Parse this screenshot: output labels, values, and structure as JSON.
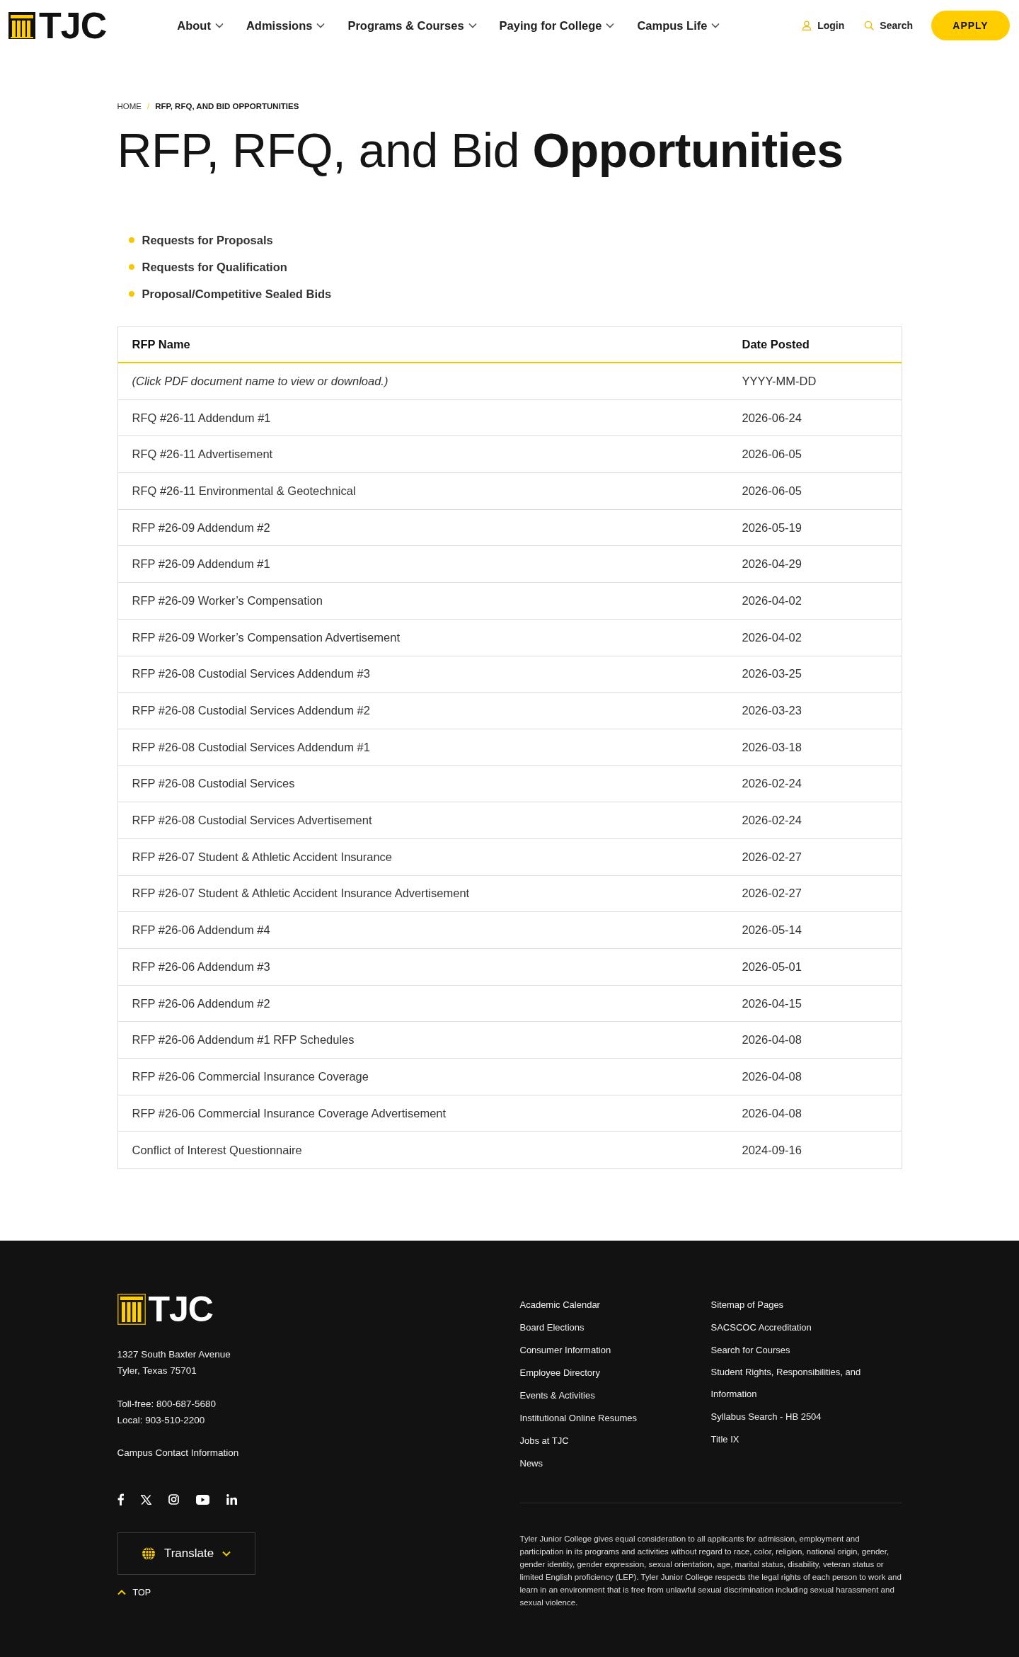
{
  "header": {
    "logo": "TJC",
    "nav": [
      "About",
      "Admissions",
      "Programs & Courses",
      "Paying for College",
      "Campus Life"
    ],
    "login": "Login",
    "search": "Search",
    "apply": "APPLY"
  },
  "breadcrumb": {
    "separator": "/",
    "items": [
      {
        "label": "HOME",
        "current": false
      },
      {
        "label": "RFP, RFQ, AND BID OPPORTUNITIES",
        "current": true
      }
    ]
  },
  "title": "RFP, RFQ, and Bid **Opportunities**",
  "categories": [
    "Requests for Proposals",
    "Requests for Qualification",
    "Proposal/Competitive Sealed Bids"
  ],
  "table": {
    "columns": [
      "RFP Name",
      "Date Posted"
    ],
    "rows": [
      {
        "kind": "note",
        "name": "(Click PDF document name to view or download.)",
        "date": "YYYY-MM-DD"
      },
      {
        "kind": "document",
        "name": "RFQ #26-11 Addendum #1",
        "date": "2026-06-24"
      },
      {
        "kind": "document",
        "name": "RFQ #26-11 Advertisement",
        "date": "2026-06-05"
      },
      {
        "kind": "document",
        "name": "RFQ #26-11 Environmental & Geotechnical",
        "date": "2026-06-05"
      },
      {
        "kind": "document",
        "name": "RFP #26-09 Addendum #2",
        "date": "2026-05-19"
      },
      {
        "kind": "document",
        "name": "RFP #26-09 Addendum #1",
        "date": "2026-04-29"
      },
      {
        "kind": "document",
        "name": "RFP #26-09 Worker’s Compensation",
        "date": "2026-04-02"
      },
      {
        "kind": "document",
        "name": "RFP #26-09 Worker’s Compensation Advertisement",
        "date": "2026-04-02"
      },
      {
        "kind": "document",
        "name": "RFP #26-08 Custodial Services Addendum #3",
        "date": "2026-03-25"
      },
      {
        "kind": "document",
        "name": "RFP #26-08 Custodial Services Addendum #2",
        "date": "2026-03-23"
      },
      {
        "kind": "document",
        "name": "RFP #26-08 Custodial Services Addendum #1",
        "date": "2026-03-18"
      },
      {
        "kind": "document",
        "name": "RFP #26-08 Custodial Services",
        "date": "2026-02-24"
      },
      {
        "kind": "document",
        "name": "RFP #26-08 Custodial Services Advertisement",
        "date": "2026-02-24"
      },
      {
        "kind": "document",
        "name": "RFP #26-07 Student & Athletic Accident Insurance",
        "date": "2026-02-27"
      },
      {
        "kind": "document",
        "name": "RFP #26-07 Student & Athletic Accident Insurance Advertisement",
        "date": "2026-02-27"
      },
      {
        "kind": "document",
        "name": "RFP #26-06 Addendum #4",
        "date": "2026-05-14"
      },
      {
        "kind": "document",
        "name": "RFP #26-06 Addendum #3",
        "date": "2026-05-01"
      },
      {
        "kind": "document",
        "name": "RFP #26-06 Addendum #2",
        "date": "2026-04-15"
      },
      {
        "kind": "document",
        "name": "RFP #26-06 Addendum #1 RFP Schedules",
        "date": "2026-04-08"
      },
      {
        "kind": "document",
        "name": "RFP #26-06 Commercial Insurance Coverage",
        "date": "2026-04-08"
      },
      {
        "kind": "document",
        "name": "RFP #26-06 Commercial Insurance Coverage Advertisement",
        "date": "2026-04-08"
      },
      {
        "kind": "document",
        "name": "Conflict of Interest Questionnaire",
        "date": "2024-09-16"
      }
    ]
  },
  "footer": {
    "logo": "TJC",
    "address": [
      "1327 South Baxter Avenue",
      "Tyler, Texas 75701"
    ],
    "phones": [
      "Toll-free: 800-687-5680",
      "Local: 903-510-2200"
    ],
    "contact": "Campus Contact Information",
    "translate": "Translate",
    "top": "TOP",
    "links": [
      [
        "Academic Calendar",
        "Board Elections",
        "Consumer Information",
        "Employee Directory",
        "Events & Activities",
        "Institutional Online Resumes",
        "Jobs at TJC",
        "News"
      ],
      [
        "Sitemap of Pages",
        "SACSCOC Accreditation",
        "Search for Courses",
        "Student Rights, Responsibilities, and Information",
        "Syllabus Search - HB 2504",
        "Title IX"
      ]
    ],
    "statement": "Tyler Junior College gives equal consideration to all applicants for admission, employment and participation in its programs and activities without regard to race, color, religion, national origin, gender, gender identity, gender expression, sexual orientation, age, marital status, disability, veteran status or limited English proficiency (LEP). Tyler Junior College respects the legal rights of each person to work and learn in an environment that is free from unlawful sexual discrimination including sexual harassment and sexual violence."
  }
}
